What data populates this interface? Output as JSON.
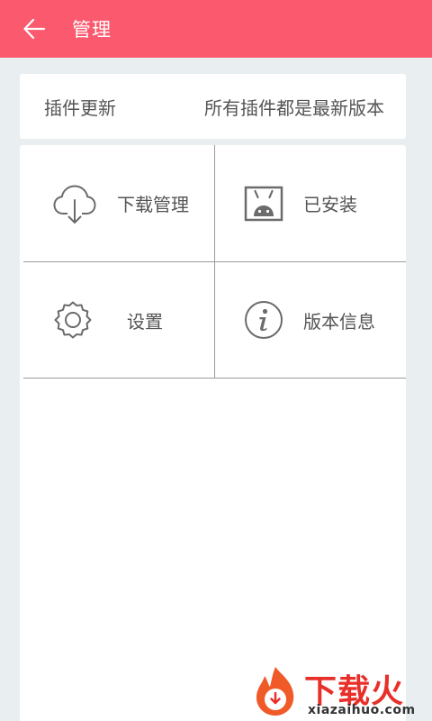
{
  "header": {
    "title": "管理",
    "back_icon": "arrow-left-icon",
    "bg_color": "#fb5a6e"
  },
  "update": {
    "label": "插件更新",
    "status": "所有插件都是最新版本"
  },
  "grid": {
    "items": [
      {
        "label": "下载管理",
        "icon": "cloud-download-icon"
      },
      {
        "label": "已安装",
        "icon": "android-box-icon"
      },
      {
        "label": "设置",
        "icon": "gear-icon"
      },
      {
        "label": "版本信息",
        "icon": "info-icon"
      }
    ]
  },
  "watermark": {
    "brand": "下载火",
    "url": "xiazaihuo.com"
  }
}
